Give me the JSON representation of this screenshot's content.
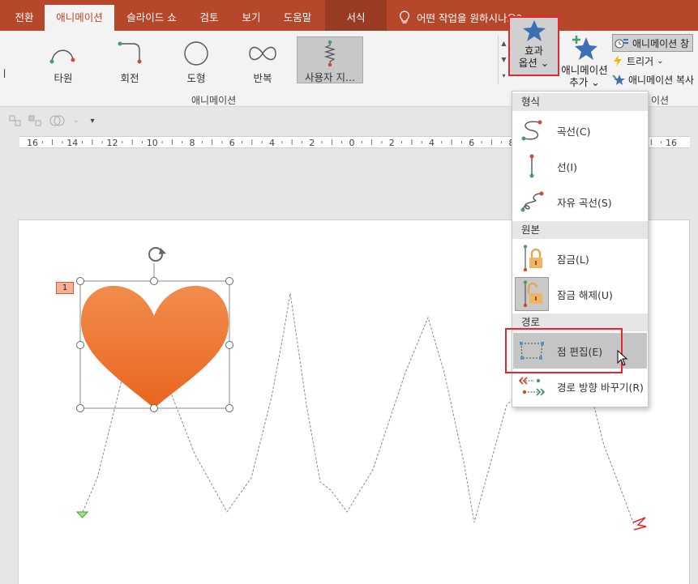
{
  "tabs": [
    {
      "label": "전환",
      "active": false
    },
    {
      "label": "애니메이션",
      "active": true
    },
    {
      "label": "슬라이드 쇼",
      "active": false
    },
    {
      "label": "검토",
      "active": false
    },
    {
      "label": "보기",
      "active": false
    },
    {
      "label": "도움말",
      "active": false
    }
  ],
  "contextual_tab": "서식",
  "tell_me": "어떤 작업을 원하시나요?",
  "ribbon": {
    "cut_label": "ㅣ",
    "effects": [
      "타원",
      "회전",
      "도형",
      "반복",
      "사용자 지..."
    ],
    "group_label": "애니메이션",
    "group_label_2": "이션",
    "effect_options": {
      "line1": "효과",
      "line2": "옵션",
      "caret": "⌄"
    },
    "add_animation": {
      "line1": "애니메이션",
      "line2": "추가",
      "caret": "⌄"
    },
    "animation_pane": "애니메이션 창",
    "trigger": "트리거",
    "trigger_caret": "⌄",
    "animation_painter": "애니메이션 복사"
  },
  "ruler": {
    "ticks": [
      "16",
      "14",
      "12",
      "10",
      "8",
      "6",
      "4",
      "2",
      "0",
      "2",
      "4",
      "6",
      "8",
      "10",
      "12",
      "14",
      "16"
    ]
  },
  "slide": {
    "animation_number": "1"
  },
  "menu": {
    "sections": [
      {
        "header": "형식",
        "items": [
          {
            "label": "곡선(C)",
            "icon": "curve-path-icon"
          },
          {
            "label": "선(I)",
            "icon": "line-path-icon"
          },
          {
            "label": "자유 곡선(S)",
            "icon": "freeform-path-icon"
          }
        ]
      },
      {
        "header": "원본",
        "items": [
          {
            "label": "잠금(L)",
            "icon": "lock-icon"
          },
          {
            "label": "잠금 해제(U)",
            "icon": "unlock-icon"
          }
        ]
      },
      {
        "header": "경로",
        "items": [
          {
            "label": "점 편집(E)",
            "icon": "edit-points-icon"
          },
          {
            "label": "경로 방향 바꾸기(R)",
            "icon": "reverse-path-icon"
          }
        ]
      }
    ]
  },
  "colors": {
    "accent": "#b7472a",
    "accent_dark": "#983b22",
    "highlight_red": "#e8262e",
    "heart_top": "#f28c4c",
    "heart_bottom": "#e8651f"
  }
}
